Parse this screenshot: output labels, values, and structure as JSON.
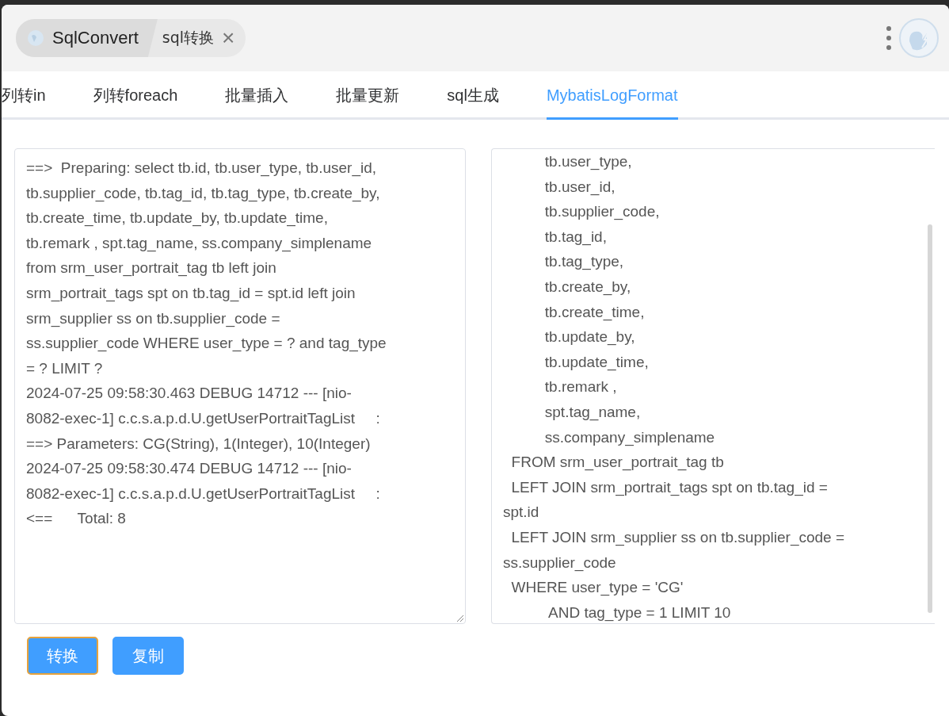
{
  "title_bar": {
    "app_name": "SqlConvert",
    "tab_title": "sql转换",
    "close": "×"
  },
  "tabs": [
    {
      "label": "列转in",
      "selected": false
    },
    {
      "label": "列转foreach",
      "selected": false
    },
    {
      "label": "批量插入",
      "selected": false
    },
    {
      "label": "批量更新",
      "selected": false
    },
    {
      "label": "sql生成",
      "selected": false
    },
    {
      "label": "MybatisLogFormat",
      "selected": true
    }
  ],
  "input_lines": [
    "==>  Preparing: select tb.id, tb.user_type, tb.user_id,",
    "tb.supplier_code, tb.tag_id, tb.tag_type, tb.create_by,",
    "tb.create_time, tb.update_by, tb.update_time,",
    "tb.remark , spt.tag_name, ss.company_simplename",
    "from srm_user_portrait_tag tb left join",
    "srm_portrait_tags spt on tb.tag_id = spt.id left join",
    "srm_supplier ss on tb.supplier_code =",
    "ss.supplier_code WHERE user_type = ? and tag_type",
    "= ? LIMIT ?",
    "2024-07-25 09:58:30.463 DEBUG 14712 --- [nio-",
    "8082-exec-1] c.c.s.a.p.d.U.getUserPortraitTagList     :",
    "==> Parameters: CG(String), 1(Integer), 10(Integer)",
    "2024-07-25 09:58:30.474 DEBUG 14712 --- [nio-",
    "8082-exec-1] c.c.s.a.p.d.U.getUserPortraitTagList     :",
    "<==      Total: 8"
  ],
  "output_lines": [
    "          tb.user_type,",
    "          tb.user_id,",
    "          tb.supplier_code,",
    "          tb.tag_id,",
    "          tb.tag_type,",
    "          tb.create_by,",
    "          tb.create_time,",
    "          tb.update_by,",
    "          tb.update_time,",
    "          tb.remark ,",
    "          spt.tag_name,",
    "          ss.company_simplename",
    "  FROM srm_user_portrait_tag tb",
    "  LEFT JOIN srm_portrait_tags spt on tb.tag_id =",
    "spt.id",
    "  LEFT JOIN srm_supplier ss on tb.supplier_code =",
    "ss.supplier_code",
    "  WHERE user_type = 'CG'",
    "           AND tag_type = 1 LIMIT 10"
  ],
  "buttons": [
    {
      "label": "转换",
      "focused": true
    },
    {
      "label": "复制",
      "focused": false
    }
  ]
}
